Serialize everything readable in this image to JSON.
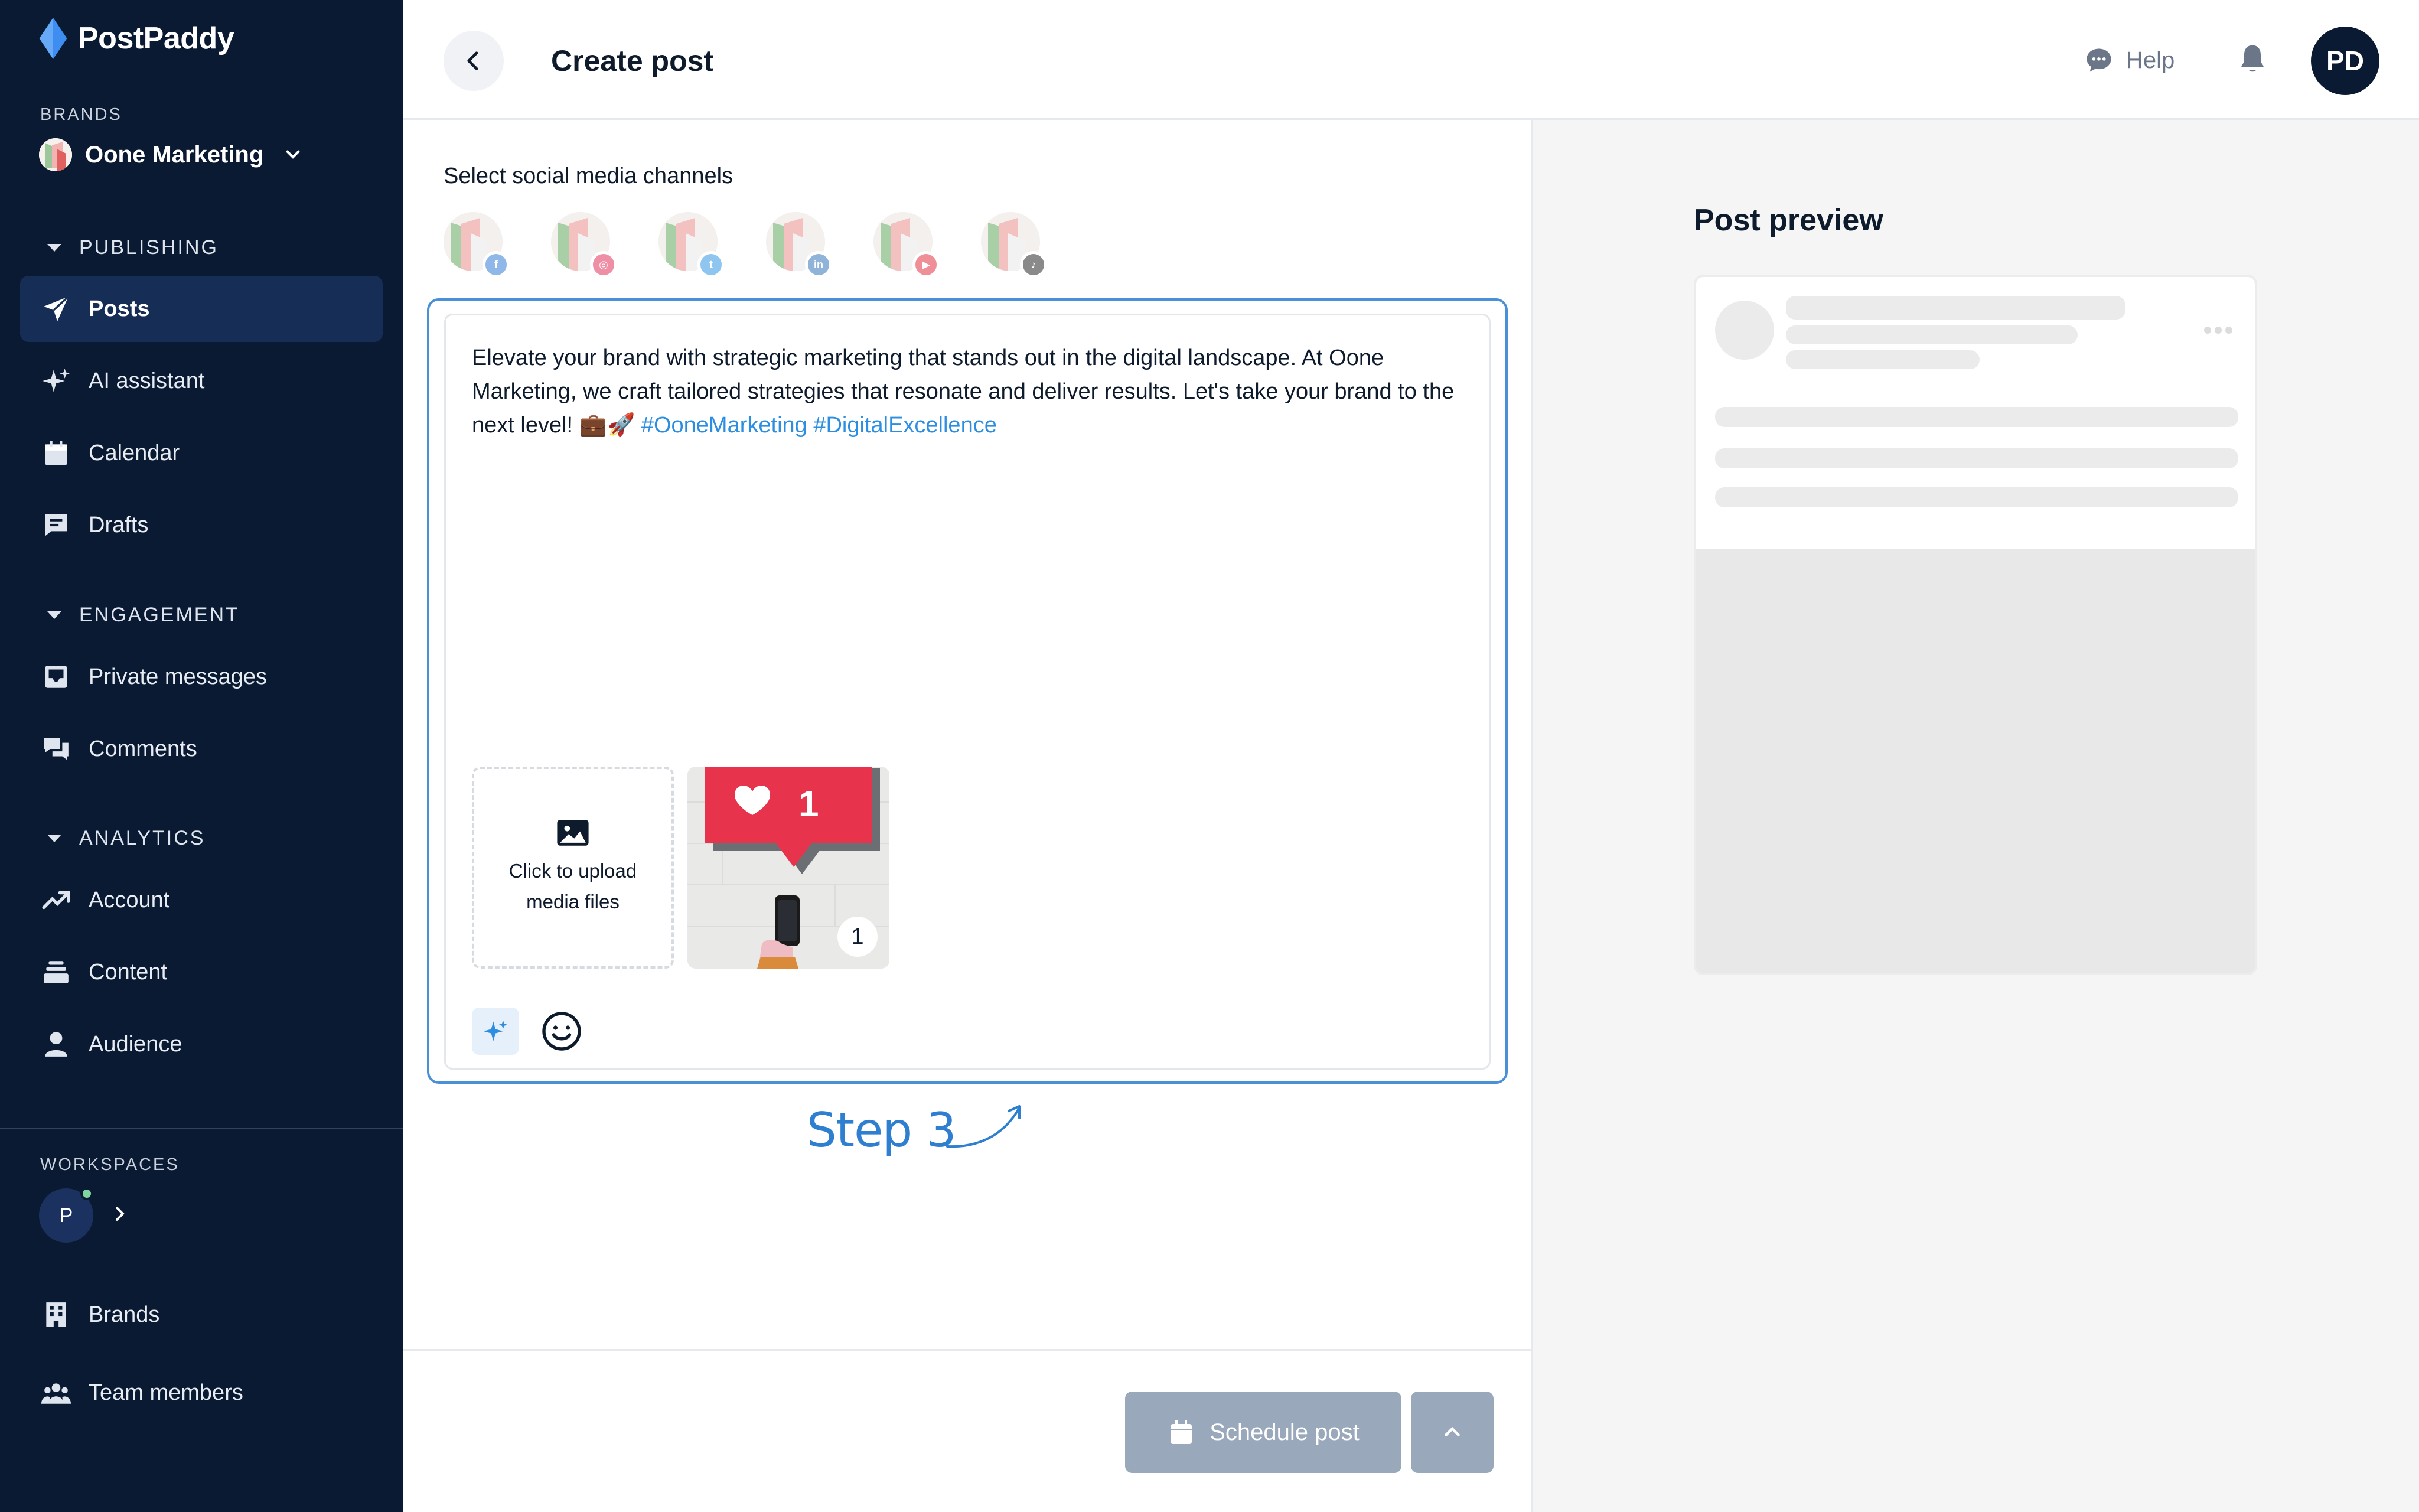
{
  "app": {
    "name": "PostPaddy",
    "page_title": "Create post"
  },
  "sidebar": {
    "brands_label": "BRANDS",
    "current_brand": "Oone Marketing",
    "sections": [
      {
        "title": "PUBLISHING",
        "items": [
          {
            "label": "Posts",
            "icon": "send-icon",
            "active": true
          },
          {
            "label": "AI assistant",
            "icon": "sparkles-icon"
          },
          {
            "label": "Calendar",
            "icon": "calendar-icon"
          },
          {
            "label": "Drafts",
            "icon": "drafts-icon"
          }
        ]
      },
      {
        "title": "ENGAGEMENT",
        "items": [
          {
            "label": "Private messages",
            "icon": "inbox-icon"
          },
          {
            "label": "Comments",
            "icon": "comments-icon"
          }
        ]
      },
      {
        "title": "ANALYTICS",
        "items": [
          {
            "label": "Account",
            "icon": "trend-icon"
          },
          {
            "label": "Content",
            "icon": "layers-icon"
          },
          {
            "label": "Audience",
            "icon": "person-icon"
          }
        ]
      }
    ],
    "workspaces_label": "WORKSPACES",
    "workspace_initial": "P",
    "bottom_items": [
      {
        "label": "Brands",
        "icon": "building-icon"
      },
      {
        "label": "Team members",
        "icon": "team-icon"
      }
    ]
  },
  "header": {
    "help_label": "Help",
    "user_initials": "PD"
  },
  "editor": {
    "channels_label": "Select social media channels",
    "channels": [
      {
        "network": "facebook",
        "badge": "f",
        "color": "#8fb8e8"
      },
      {
        "network": "instagram",
        "badge": "◎",
        "color": "#ef8fa6"
      },
      {
        "network": "twitter",
        "badge": "t",
        "color": "#8ec6ef"
      },
      {
        "network": "linkedin",
        "badge": "in",
        "color": "#8fb3d9"
      },
      {
        "network": "youtube",
        "badge": "▶",
        "color": "#ef8f97"
      },
      {
        "network": "tiktok",
        "badge": "♪",
        "color": "#8a8a8a"
      }
    ],
    "post_text": "Elevate your brand with strategic marketing that stands out in the digital landscape. At Oone Marketing, we craft tailored strategies that resonate and deliver results. Let's take your brand to the next level! 💼🚀 ",
    "hashtags": "#OoneMarketing #DigitalExcellence",
    "upload_text_line1": "Click to upload",
    "upload_text_line2": "media files",
    "media_count": "1",
    "annotation": "Step 3",
    "schedule_label": "Schedule post"
  },
  "preview": {
    "title": "Post preview"
  },
  "colors": {
    "sidebar_bg": "#0b1a33",
    "active_item_bg": "#162d55",
    "accent_blue": "#4a90d9",
    "hashtag_blue": "#2c8ee0",
    "disabled_button": "#9aa8bb"
  }
}
